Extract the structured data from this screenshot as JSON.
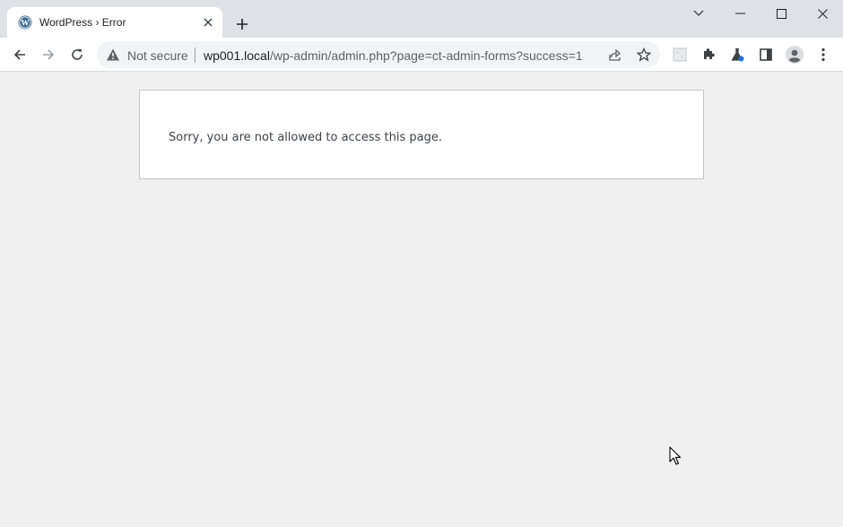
{
  "browser": {
    "tab": {
      "title": "WordPress › Error",
      "favicon": "wordpress-icon"
    },
    "window_controls": [
      "tab-search-icon",
      "minimize-icon",
      "maximize-icon",
      "close-icon"
    ],
    "toolbar": {
      "security_label": "Not secure",
      "url_host": "wp001.local",
      "url_path": "/wp-admin/admin.php?page=ct-admin-forms?success=1",
      "icons": [
        "back-icon",
        "forward-icon",
        "reload-icon",
        "share-icon",
        "bookmark-star-icon",
        "extension-icon",
        "puzzle-icon",
        "flask-icon",
        "sidepanel-icon",
        "profile-icon",
        "menu-icon"
      ]
    }
  },
  "page": {
    "message": "Sorry, you are not allowed to access this page."
  },
  "colors": {
    "tabstrip": "#dee1e6",
    "page_bg": "#f0f0f1",
    "box_border": "#c3c4c7",
    "text": "#3c434a"
  }
}
